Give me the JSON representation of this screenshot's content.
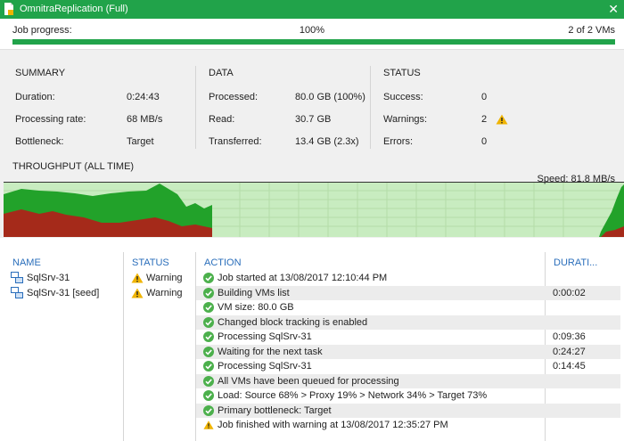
{
  "window": {
    "title": "OmnitraReplication (Full)"
  },
  "progress": {
    "label": "Job progress:",
    "percent_text": "100%",
    "percent": 100,
    "vms_text": "2 of 2 VMs"
  },
  "summary": {
    "heading": "SUMMARY",
    "rows": [
      {
        "label": "Duration:",
        "value": "0:24:43"
      },
      {
        "label": "Processing rate:",
        "value": "68 MB/s"
      },
      {
        "label": "Bottleneck:",
        "value": "Target"
      }
    ]
  },
  "data_section": {
    "heading": "DATA",
    "rows": [
      {
        "label": "Processed:",
        "value": "80.0 GB (100%)"
      },
      {
        "label": "Read:",
        "value": "30.7 GB"
      },
      {
        "label": "Transferred:",
        "value": "13.4 GB (2.3x)"
      }
    ]
  },
  "status_section": {
    "heading": "STATUS",
    "rows": [
      {
        "label": "Success:",
        "value": "0"
      },
      {
        "label": "Warnings:",
        "value": "2"
      },
      {
        "label": "Errors:",
        "value": "0"
      }
    ]
  },
  "throughput": {
    "title": "THROUGHPUT (ALL TIME)",
    "speed_label": "Speed: 81.8 MB/s"
  },
  "vm_list": {
    "headers": {
      "name": "NAME",
      "status": "STATUS"
    },
    "items": [
      {
        "name": "SqlSrv-31",
        "status": "Warning"
      },
      {
        "name": "SqlSrv-31 [seed]",
        "status": "Warning"
      }
    ]
  },
  "actions": {
    "headers": {
      "action": "ACTION",
      "duration": "DURATI..."
    },
    "items": [
      {
        "icon": "check",
        "text": "Job started at 13/08/2017 12:10:44 PM",
        "duration": ""
      },
      {
        "icon": "check",
        "text": "Building VMs list",
        "duration": "0:00:02"
      },
      {
        "icon": "check",
        "text": "VM size: 80.0 GB",
        "duration": ""
      },
      {
        "icon": "check",
        "text": "Changed block tracking is enabled",
        "duration": ""
      },
      {
        "icon": "check",
        "text": "Processing SqlSrv-31",
        "duration": "0:09:36"
      },
      {
        "icon": "check",
        "text": "Waiting for the next task",
        "duration": "0:24:27"
      },
      {
        "icon": "check",
        "text": "Processing SqlSrv-31",
        "duration": "0:14:45"
      },
      {
        "icon": "check",
        "text": "All VMs have been queued for processing",
        "duration": ""
      },
      {
        "icon": "check",
        "text": "Load: Source 68% > Proxy 19% > Network 34% > Target 73%",
        "duration": ""
      },
      {
        "icon": "check",
        "text": "Primary bottleneck: Target",
        "duration": ""
      },
      {
        "icon": "warning",
        "text": "Job finished with warning at 13/08/2017 12:35:27 PM",
        "duration": ""
      }
    ]
  },
  "colors": {
    "accent": "#21a34a",
    "success": "#4cb04c",
    "warning": "#f0b400",
    "link": "#2a6ebb",
    "chart_green": "#22a22a",
    "chart_red": "#a52a1a",
    "chart_bg": "#c8ecc0"
  }
}
